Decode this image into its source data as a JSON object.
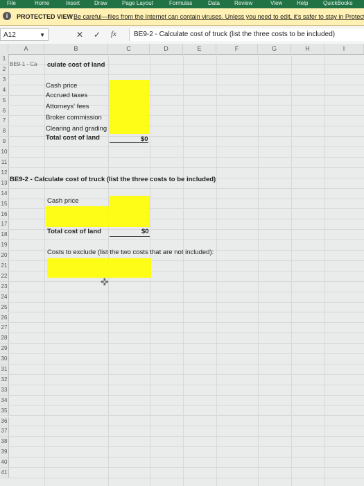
{
  "ribbon": {
    "tabs": [
      "File",
      "Home",
      "Insert",
      "Draw",
      "Page Layout",
      "Formulas",
      "Data",
      "Review",
      "View",
      "Help",
      "QuickBooks"
    ]
  },
  "protected_view": {
    "title": "PROTECTED VIEW",
    "message": "Be careful—files from the Internet can contain viruses. Unless you need to edit, it's safer to stay in Protected"
  },
  "formula_bar": {
    "name_box": "A12",
    "fx": "fx",
    "cancel": "✕",
    "enter": "✓",
    "content": "BE9-2 - Calculate cost of truck (list the three costs to be included)"
  },
  "columns": [
    "A",
    "B",
    "C",
    "D",
    "E",
    "F",
    "G",
    "H",
    "I"
  ],
  "row_numbers": [
    "1",
    "2",
    "3",
    "4",
    "5",
    "6",
    "7",
    "8",
    "9",
    "10",
    "11",
    "12",
    "13",
    "14",
    "15",
    "16",
    "17",
    "18",
    "19",
    "20",
    "21",
    "22",
    "23",
    "24",
    "25",
    "26",
    "27",
    "28",
    "29",
    "30",
    "31",
    "32",
    "33",
    "34",
    "35",
    "36",
    "37",
    "38",
    "39",
    "40",
    "41"
  ],
  "sheet": {
    "be91_label": "BE9-1 - Ca",
    "be91_title": "culate cost of land",
    "land_items": [
      "Cash price",
      "Accrued taxes",
      "Attorneys' fees",
      "Broker commission",
      "Clearing and grading"
    ],
    "land_total_label": "Total cost of land",
    "land_total_value": "$0",
    "be92_title": "BE9-2 - Calculate cost of truck (list the three costs to be included)",
    "truck_cash_price": "Cash price",
    "truck_total_label": "Total cost of land",
    "truck_total_value": "$0",
    "exclude_label": "Costs to exclude (list the two costs that are not included):"
  },
  "colors": {
    "ribbon": "#217346",
    "highlight": "#ffff00",
    "protected_bar": "#fff1b3"
  }
}
